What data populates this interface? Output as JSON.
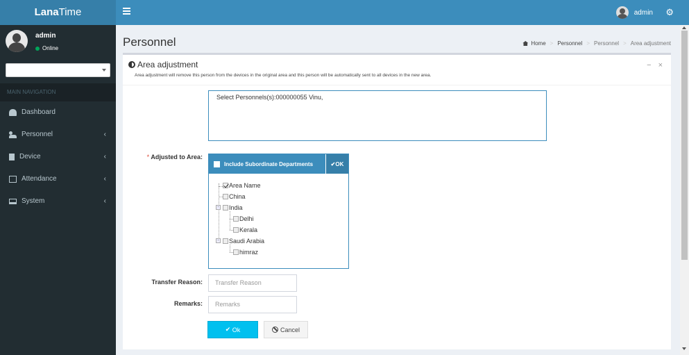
{
  "app": {
    "logo_bold": "Lana",
    "logo_rest": "Time"
  },
  "header": {
    "user_name": "admin"
  },
  "sidebar": {
    "user": {
      "name": "admin",
      "status": "Online"
    },
    "nav_header": "MAIN NAVIGATION",
    "items": [
      {
        "label": "Dashboard",
        "icon": "dashboard-icon",
        "has_children": false
      },
      {
        "label": "Personnel",
        "icon": "users-icon",
        "has_children": true
      },
      {
        "label": "Device",
        "icon": "device-icon",
        "has_children": true
      },
      {
        "label": "Attendance",
        "icon": "attendance-icon",
        "has_children": true
      },
      {
        "label": "System",
        "icon": "laptop-icon",
        "has_children": true
      }
    ]
  },
  "page": {
    "title": "Personnel",
    "breadcrumb": [
      "Home",
      "Personnel",
      "Personnel",
      "Area adjustment"
    ]
  },
  "box": {
    "title": "Area adjustment",
    "description": "Area adjustment will remove this person from the devices in the original area and this person will be automatically sent to all devices in the new area.",
    "selected_personnel": "Select Personnels(s):000000055 Vinu,"
  },
  "form": {
    "area_label": "Adjusted to Area:",
    "area_required_mark": "*",
    "include_sub_label": "Include Subordinate Departments",
    "ok_small": "OK",
    "tree": [
      {
        "label": "Area Name",
        "checked": true
      },
      {
        "label": "China",
        "checked": false
      },
      {
        "label": "India",
        "checked": false
      },
      {
        "label": "Delhi",
        "checked": false
      },
      {
        "label": "Kerala",
        "checked": false
      },
      {
        "label": "Saudi Arabia",
        "checked": false
      },
      {
        "label": "himraz",
        "checked": false
      }
    ],
    "transfer_reason_label": "Transfer Reason:",
    "transfer_reason_placeholder": "Transfer Reason",
    "remarks_label": "Remarks:",
    "remarks_placeholder": "Remarks",
    "ok_button": "Ok",
    "cancel_button": "Cancel"
  },
  "colors": {
    "header": "#3c8dbc",
    "sidebar": "#222d32",
    "ok_button": "#00c0ef"
  }
}
